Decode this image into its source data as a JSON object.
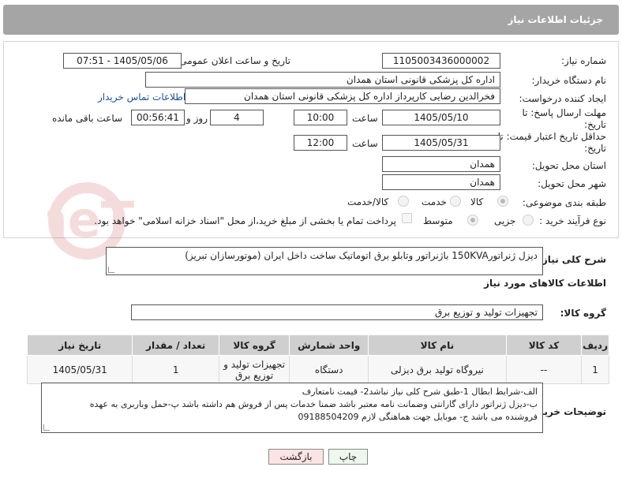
{
  "header": {
    "title": "جزئیات اطلاعات نیاز"
  },
  "fields": {
    "need_number_label": "شماره نیاز:",
    "need_number": "1105003436000002",
    "announce_label": "تاریخ و ساعت اعلان عمومی:",
    "announce_value": "1405/05/06 - 07:51",
    "buyer_org_label": "نام دستگاه خریدار:",
    "buyer_org": "اداره کل پزشکی قانونی استان همدان",
    "creator_label": "ایجاد کننده درخواست:",
    "creator": "فخرالدین رضایی کارپرداز اداره کل پزشکی قانونی استان همدان",
    "contact_link": "اطلاعات تماس خریدار",
    "deadline_label": "مهلت ارسال پاسخ: تا تاریخ:",
    "deadline_date": "1405/05/10",
    "time_label": "ساعت",
    "deadline_time": "10:00",
    "days_value": "4",
    "days_label": "روز و",
    "remaining_time": "00:56:41",
    "remaining_label": "ساعت باقی مانده",
    "validity_label": "حداقل تاریخ اعتبار قیمت: تا تاریخ:",
    "validity_date": "1405/05/31",
    "validity_time": "12:00",
    "province_label": "استان محل تحویل:",
    "province": "همدان",
    "city_label": "شهر محل تحویل:",
    "city": "همدان",
    "category_label": "طبقه بندی موضوعی:",
    "category_options": [
      "کالا",
      "خدمت",
      "کالا/خدمت"
    ],
    "process_label": "نوع فرآیند خرید :",
    "process_options": [
      "جزیی",
      "متوسط"
    ],
    "payment_note": "پرداخت تمام یا بخشی از مبلغ خرید،از محل \"اسناد خزانه اسلامی\" خواهد بود."
  },
  "summary": {
    "label": "شرح کلی نیاز:",
    "text": "دیزل ژنراتور150KVA باژنراتور وتابلو برق اتوماتیک ساخت داخل ایران (موتورسازان تبریز)"
  },
  "goods": {
    "section_title": "اطلاعات کالاهای مورد نیاز",
    "group_label": "گروه کالا:",
    "group_value": "تجهیزات تولید و توزیع برق",
    "columns": [
      "ردیف",
      "کد کالا",
      "نام کالا",
      "واحد شمارش",
      "گروه کالا",
      "تعداد / مقدار",
      "تاریخ نیاز"
    ],
    "rows": [
      [
        "1",
        "--",
        "نیروگاه تولید برق دیزلی",
        "دستگاه",
        "تجهیزات تولید و توزیع برق",
        "1",
        "1405/05/31"
      ]
    ]
  },
  "buyer_notes": {
    "label": "توضیحات خریدار:",
    "lines": [
      "الف-شرایط ابطال 1-طبق شرح کلی نیاز  نباشد2- قیمت نامتعارف",
      "ب-دیزل ژنراتور دارای گارانتی وضمانت نامه معتبر باشد ضمنا خدمات پس از فروش هم داشته باشد پ-حمل وباربری به عهده",
      "فروشنده می باشد ج- موبایل جهت هماهنگی لازم 09188504209"
    ]
  },
  "buttons": {
    "print": "چاپ",
    "back": "بازگشت"
  },
  "watermark": {
    "text": "AriaTender.neT"
  },
  "colors": {
    "header_bg": "#a5a5a5",
    "link": "#1a4fa0",
    "back_btn_bg": "#fbe4e4",
    "print_btn_bg": "#eef7ee"
  }
}
